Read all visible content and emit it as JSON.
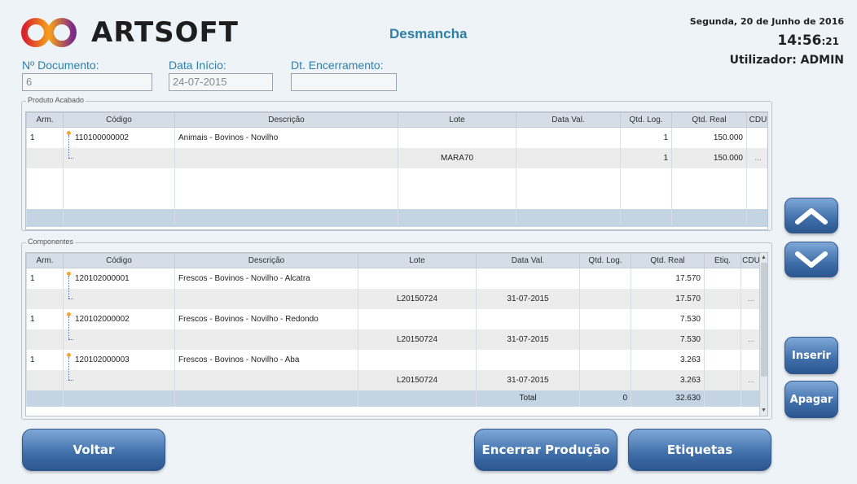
{
  "brand": {
    "name": "ARTSOFT"
  },
  "title": "Desmancha",
  "datetime": {
    "date": "Segunda, 20 de Junho de 2016",
    "time_hm": "14:56",
    "time_s": ":21"
  },
  "user": "Utilizador: ADMIN",
  "fields": {
    "documento": {
      "label": "Nº Documento:",
      "value": "6"
    },
    "data_inicio": {
      "label": "Data Início:",
      "value": "24-07-2015"
    },
    "encerramento": {
      "label": "Dt. Encerramento:",
      "value": ""
    }
  },
  "produto": {
    "legend": "Produto Acabado",
    "columns": [
      "Arm.",
      "Código",
      "Descrição",
      "Lote",
      "Data Val.",
      "Qtd. Log.",
      "Qtd. Real",
      "CDU"
    ],
    "rows": [
      {
        "arm": "1",
        "codigo": "110100000002",
        "descricao": "Animais - Bovinos - Novilho",
        "lote": "",
        "data_val": "",
        "qtd_log": "1",
        "qtd_real": "150.000",
        "cdu": ""
      },
      {
        "arm": "",
        "codigo": "",
        "descricao": "",
        "lote": "MARA70",
        "data_val": "",
        "qtd_log": "1",
        "qtd_real": "150.000",
        "cdu": "..."
      }
    ]
  },
  "componentes": {
    "legend": "Componentes",
    "columns": [
      "Arm.",
      "Código",
      "Descrição",
      "Lote",
      "Data Val.",
      "Qtd. Log.",
      "Qtd. Real",
      "Etiq.",
      "CDU"
    ],
    "rows": [
      {
        "arm": "1",
        "codigo": "120102000001",
        "descricao": "Frescos - Bovinos - Novilho - Alcatra",
        "lote": "",
        "data_val": "",
        "qtd_log": "",
        "qtd_real": "17.570",
        "etiq": "",
        "cdu": ""
      },
      {
        "arm": "",
        "codigo": "",
        "descricao": "",
        "lote": "L20150724",
        "data_val": "31-07-2015",
        "qtd_log": "",
        "qtd_real": "17.570",
        "etiq": "",
        "cdu": "..."
      },
      {
        "arm": "1",
        "codigo": "120102000002",
        "descricao": "Frescos - Bovinos - Novilho - Redondo",
        "lote": "",
        "data_val": "",
        "qtd_log": "",
        "qtd_real": "7.530",
        "etiq": "",
        "cdu": ""
      },
      {
        "arm": "",
        "codigo": "",
        "descricao": "",
        "lote": "L20150724",
        "data_val": "31-07-2015",
        "qtd_log": "",
        "qtd_real": "7.530",
        "etiq": "",
        "cdu": "..."
      },
      {
        "arm": "1",
        "codigo": "120102000003",
        "descricao": "Frescos - Bovinos - Novilho - Aba",
        "lote": "",
        "data_val": "",
        "qtd_log": "",
        "qtd_real": "3.263",
        "etiq": "",
        "cdu": ""
      },
      {
        "arm": "",
        "codigo": "",
        "descricao": "",
        "lote": "L20150724",
        "data_val": "31-07-2015",
        "qtd_log": "",
        "qtd_real": "3.263",
        "etiq": "",
        "cdu": "..."
      }
    ],
    "total": {
      "label": "Total",
      "qtd_log": "0",
      "qtd_real": "32.630"
    }
  },
  "buttons": {
    "voltar": "Voltar",
    "encerrar": "Encerrar Produção",
    "etiquetas": "Etiquetas",
    "inserir": "Inserir",
    "apagar": "Apagar"
  },
  "icons": {
    "up": "chevron-up-icon",
    "down": "chevron-down-icon"
  },
  "colors": {
    "accent": "#2e7fa7",
    "button": "#3f6ea8",
    "logo_orange": "#f39a1e",
    "logo_red": "#d9232d"
  }
}
